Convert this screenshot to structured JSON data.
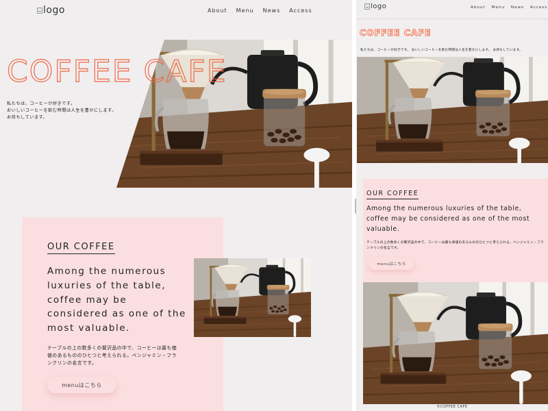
{
  "site": {
    "logo_alt": "logo",
    "nav": [
      "About",
      "Menu",
      "News",
      "Access"
    ],
    "hero": {
      "title": "COFFEE CAFE",
      "description_lines": [
        "私たちは、コーヒーが好きです。",
        "おいしいコーヒーを飲む時間は人生を豊かにします。",
        "お待ちしています。"
      ],
      "description_inline": "私たちは、コーヒーが好きです。 おいしいコーヒーを飲む時間は人生を豊かにします。 お待ちしています。"
    },
    "our_coffee": {
      "title": "OUR COFFEE",
      "lead": "Among the numerous luxuries of the table, coffee may be considered as one of the most valuable.",
      "quote_jp": "テーブルの上の数多くの贅沢品の中で、コーヒーは最も価値のあるもののひとつと考えられる。ベンジャミン・フランクリンの名言です。",
      "menu_button": "menuはこちら"
    },
    "footer": "©COFFEE CAFE"
  },
  "colors": {
    "page_bg": "#f1eef0",
    "accent_outline": "#ee6a45",
    "pink": "#fbdfe0",
    "text": "#222222"
  },
  "icons": {
    "logo": "broken-image-icon",
    "resize_handle": "grip-icon"
  }
}
